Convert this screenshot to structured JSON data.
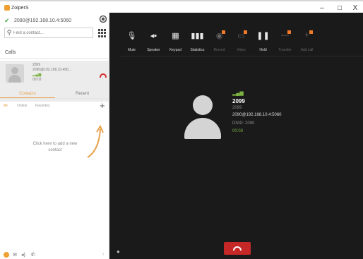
{
  "app": {
    "title": "ZoiperS"
  },
  "window_controls": {
    "minimize": "–",
    "maximize": "□",
    "close": "X"
  },
  "account": {
    "address": "2090@192.168.10.4:5060"
  },
  "search": {
    "placeholder": "Find a contact..."
  },
  "calls": {
    "header": "Calls",
    "items": [
      {
        "name": "2099",
        "address": "2090@192.168.10.450...",
        "signal": "▂▄▆",
        "duration": "00:03"
      }
    ]
  },
  "contacts": {
    "tabs": [
      "Contacts",
      "Recent"
    ],
    "filters": [
      "All",
      "Online",
      "Favorites"
    ],
    "add_label": "+",
    "empty_hint": "Click here to add a new contact"
  },
  "toolbar": {
    "items": [
      {
        "label": "Mute",
        "icon": "microphone-icon",
        "enabled": true,
        "badge": false
      },
      {
        "label": "Speaker",
        "icon": "speaker-icon",
        "enabled": true,
        "badge": false
      },
      {
        "label": "Keypad",
        "icon": "keypad-icon",
        "enabled": true,
        "badge": false
      },
      {
        "label": "Statistics",
        "icon": "statistics-icon",
        "enabled": true,
        "badge": false
      },
      {
        "label": "Record",
        "icon": "record-icon",
        "enabled": false,
        "badge": true
      },
      {
        "label": "Video",
        "icon": "video-icon",
        "enabled": false,
        "badge": true
      },
      {
        "label": "Hold",
        "icon": "pause-icon",
        "enabled": true,
        "badge": false
      },
      {
        "label": "Transfer",
        "icon": "transfer-icon",
        "enabled": false,
        "badge": true
      },
      {
        "label": "Add call",
        "icon": "add-call-icon",
        "enabled": false,
        "badge": true
      }
    ]
  },
  "active_call": {
    "signal": "▂▄▆",
    "name": "2099",
    "number": "2099",
    "address": "2090@192.168.10.4:5060",
    "dnid": "DNID: 2090",
    "duration": "00:03"
  },
  "colors": {
    "accent": "#e8a24a",
    "hangup": "#c62828",
    "signal_green": "#7cb342",
    "dark_bg": "#1a1a1a"
  }
}
